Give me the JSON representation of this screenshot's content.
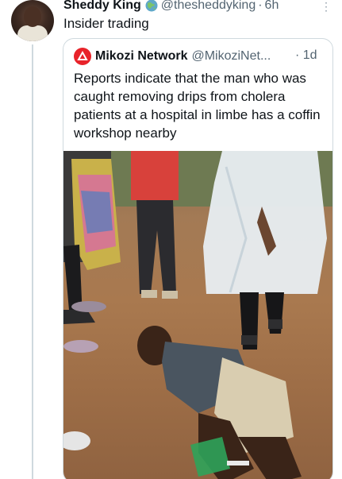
{
  "tweet": {
    "author_name": "Sheddy King",
    "handle": "@thesheddyking",
    "separator": "·",
    "time": "6h",
    "text": "Insider trading"
  },
  "quoted_tweet": {
    "author_name": "Mikozi Network",
    "handle": "@MikoziNet...",
    "time": "· 1d",
    "text": "Reports indicate that the man who was caught removing drips from cholera patients at a hospital in limbe has a coffin workshop nearby"
  },
  "icons": {
    "verified": "globe-badge-icon",
    "more": "more-icon",
    "brand": "mikozi-logo-icon"
  },
  "colors": {
    "link_gray": "#536471",
    "border": "#cfd9de",
    "brand_red": "#e8232a"
  }
}
